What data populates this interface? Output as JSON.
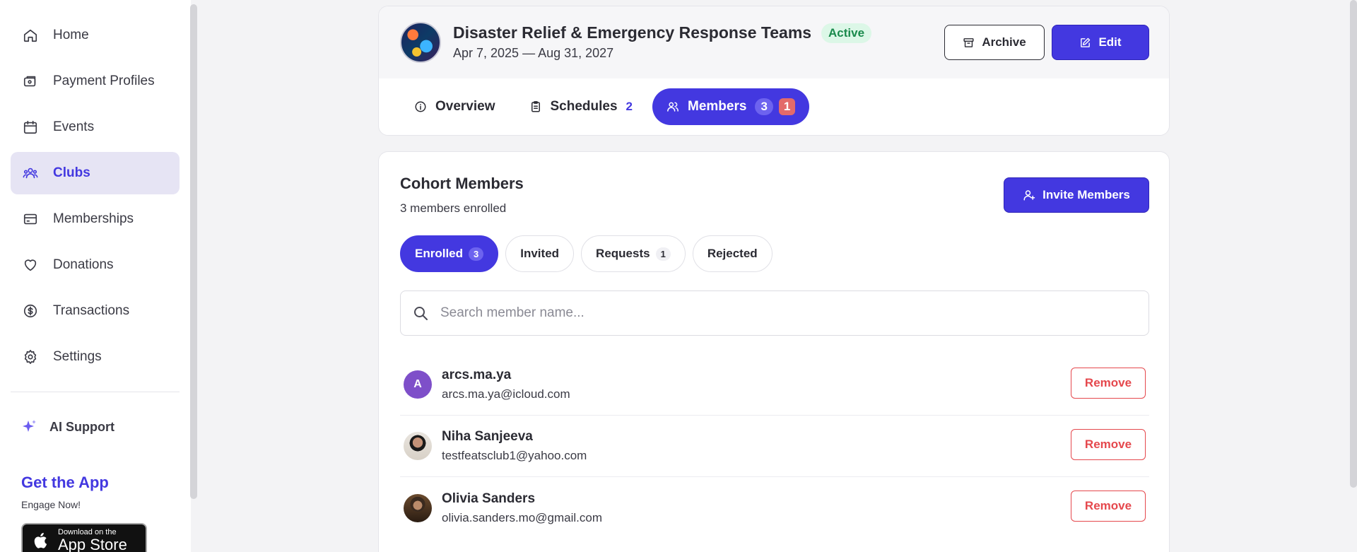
{
  "sidebar": {
    "items": [
      {
        "label": "Home",
        "icon": "home-icon"
      },
      {
        "label": "Payment Profiles",
        "icon": "wallet-icon"
      },
      {
        "label": "Events",
        "icon": "calendar-icon"
      },
      {
        "label": "Clubs",
        "icon": "users-icon",
        "active": true
      },
      {
        "label": "Memberships",
        "icon": "card-icon"
      },
      {
        "label": "Donations",
        "icon": "heart-icon"
      },
      {
        "label": "Transactions",
        "icon": "dollar-circle-icon"
      },
      {
        "label": "Settings",
        "icon": "gear-icon"
      }
    ],
    "ai_support": "AI Support",
    "get_app": "Get the App",
    "engage": "Engage Now!",
    "appstore_line1": "Download on the",
    "appstore_line2": "App Store"
  },
  "club": {
    "title": "Disaster Relief & Emergency Response Teams",
    "status": "Active",
    "dates": "Apr 7, 2025  —  Aug 31, 2027",
    "archive_label": "Archive",
    "edit_label": "Edit"
  },
  "tabs": [
    {
      "label": "Overview"
    },
    {
      "label": "Schedules",
      "count": "2"
    },
    {
      "label": "Members",
      "count": "3",
      "alert": "1",
      "active": true
    }
  ],
  "members_section": {
    "title": "Cohort Members",
    "subtitle": "3 members enrolled",
    "invite_label": "Invite Members",
    "filters": [
      {
        "label": "Enrolled",
        "count": "3",
        "active": true
      },
      {
        "label": "Invited"
      },
      {
        "label": "Requests",
        "count": "1"
      },
      {
        "label": "Rejected"
      }
    ],
    "search_placeholder": "Search member name...",
    "remove_label": "Remove",
    "members": [
      {
        "name": "arcs.ma.ya",
        "email": "arcs.ma.ya@icloud.com",
        "initial": "A"
      },
      {
        "name": "Niha Sanjeeva",
        "email": "testfeatsclub1@yahoo.com"
      },
      {
        "name": "Olivia Sanders",
        "email": "olivia.sanders.mo@gmail.com"
      }
    ]
  },
  "colors": {
    "accent": "#4338e0",
    "danger": "#e5484d",
    "success_bg": "#dcf7e7",
    "success_text": "#1a8a4c"
  }
}
